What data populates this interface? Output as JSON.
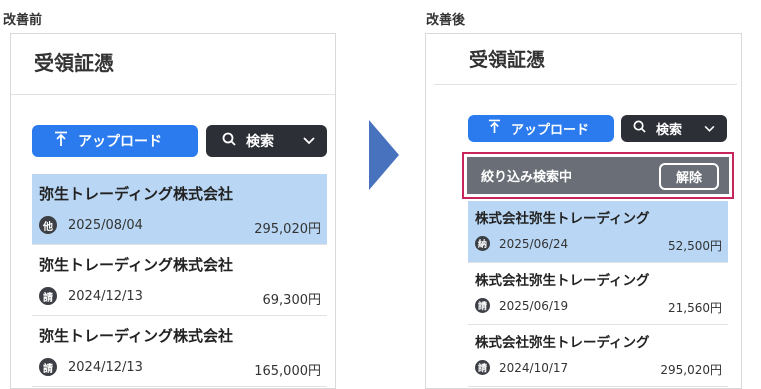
{
  "before": {
    "caption": "改善前",
    "title": "受領証憑",
    "upload_label": "アップロード",
    "search_label": "検索",
    "items": [
      {
        "name": "弥生トレーディング株式会社",
        "badge": "他",
        "date": "2025/08/04",
        "amount": "295,020円",
        "selected": true
      },
      {
        "name": "弥生トレーディング株式会社",
        "badge": "請",
        "date": "2024/12/13",
        "amount": "69,300円",
        "selected": false
      },
      {
        "name": "弥生トレーディング株式会社",
        "badge": "請",
        "date": "2024/12/13",
        "amount": "165,000円",
        "selected": false
      }
    ]
  },
  "after": {
    "caption": "改善後",
    "title": "受領証憑",
    "upload_label": "アップロード",
    "search_label": "検索",
    "filter_status": "絞り込み検索中",
    "clear_label": "解除",
    "items": [
      {
        "name": "株式会社弥生トレーディング",
        "badge": "納",
        "date": "2025/06/24",
        "amount": "52,500円",
        "selected": true
      },
      {
        "name": "株式会社弥生トレーディング",
        "badge": "請",
        "date": "2025/06/19",
        "amount": "21,560円",
        "selected": false
      },
      {
        "name": "株式会社弥生トレーディング",
        "badge": "請",
        "date": "2024/10/17",
        "amount": "295,020円",
        "selected": false
      }
    ]
  },
  "colors": {
    "accent_blue": "#2b7bef",
    "dark_button": "#2c2f36",
    "selected_row": "#b9d7f4",
    "filter_bar": "#6a6f77",
    "highlight_border": "#c8265a",
    "arrow": "#4872bd"
  },
  "icons": {
    "upload": "upload-icon",
    "search": "search-icon",
    "dropdown": "chevron-down-icon",
    "arrow": "right-arrow-icon"
  }
}
